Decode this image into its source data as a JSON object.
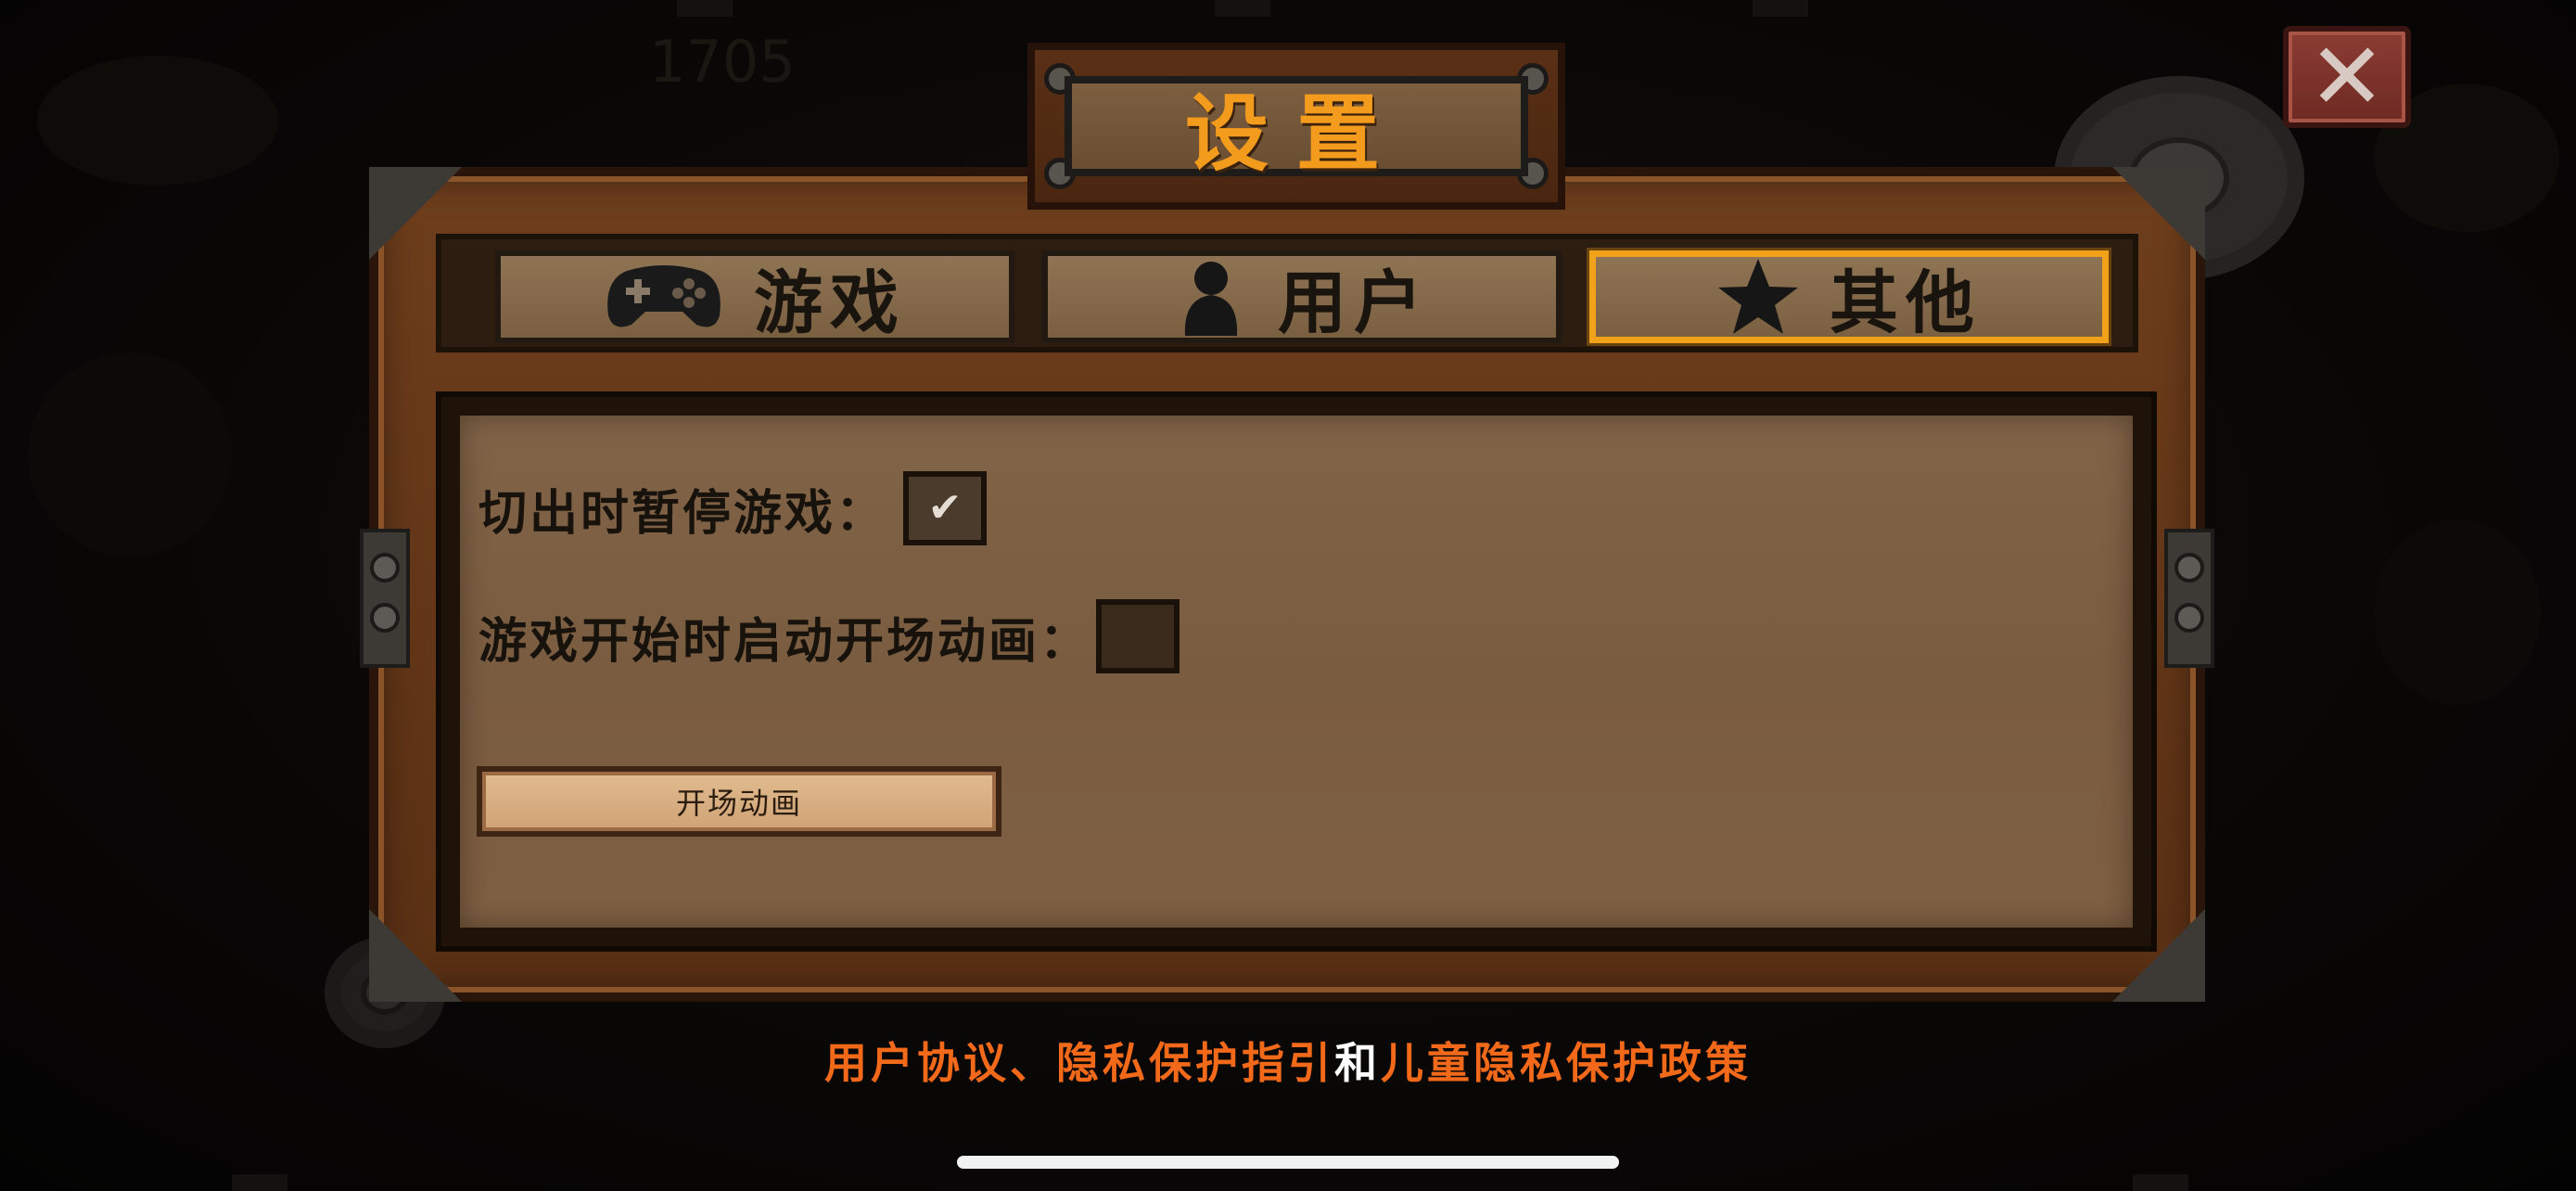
{
  "background": {
    "score": "1705"
  },
  "close_button": {
    "icon": "close-icon"
  },
  "title": "设置",
  "tabs": [
    {
      "label": "游戏",
      "icon": "gamepad-icon",
      "active": false
    },
    {
      "label": "用户",
      "icon": "user-icon",
      "active": false
    },
    {
      "label": "其他",
      "icon": "star-icon",
      "active": true
    }
  ],
  "options": {
    "pause_on_switch": {
      "label": "切出时暂停游戏：",
      "checked": true
    },
    "play_intro_on_start": {
      "label": "游戏开始时启动开场动画：",
      "checked": false
    }
  },
  "intro_button": {
    "label": "开场动画"
  },
  "footer": {
    "user_agreement": "用户协议",
    "separator": "、",
    "privacy_guide": "隐私保护指引",
    "and": "和",
    "child_privacy": "儿童隐私保护政策"
  },
  "colors": {
    "accent_orange": "#f39b1c",
    "link_orange": "#f2691a",
    "panel_wood": "#6e3e1c",
    "parchment": "#816448"
  }
}
